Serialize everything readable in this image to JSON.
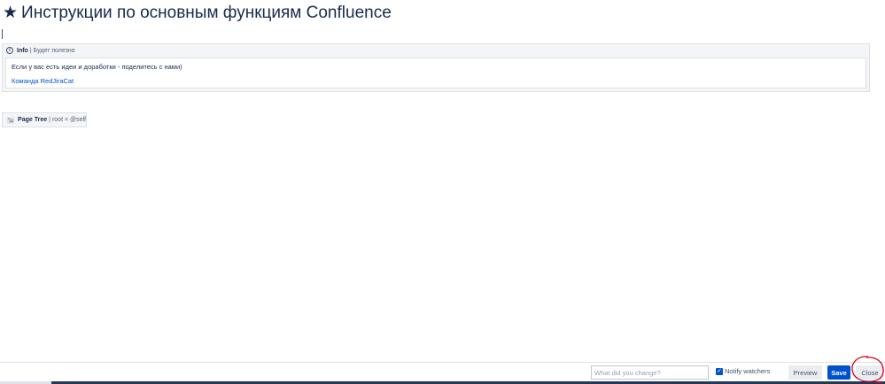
{
  "page": {
    "title": "Инструкции по основным функциям Confluence",
    "star_glyph": "★"
  },
  "info_macro": {
    "title": "Info",
    "separator": "|",
    "param": "Будет полезно",
    "line1": "Если у вас есть идеи и доработки - поделитесь с нами)",
    "line2": "Команда RedJiraCat",
    "icon": "info-circle-icon"
  },
  "pagetree_macro": {
    "title": "Page Tree",
    "separator": "|",
    "param": "root = @self",
    "icon": "page-tree-icon"
  },
  "footer": {
    "change_placeholder": "What did you change?",
    "change_value": "",
    "notify_label": "Notify watchers",
    "notify_checked": true,
    "preview_label": "Preview",
    "save_label": "Save",
    "close_label": "Close"
  },
  "colors": {
    "accent": "#0052cc",
    "annotation": "#d0021b"
  }
}
